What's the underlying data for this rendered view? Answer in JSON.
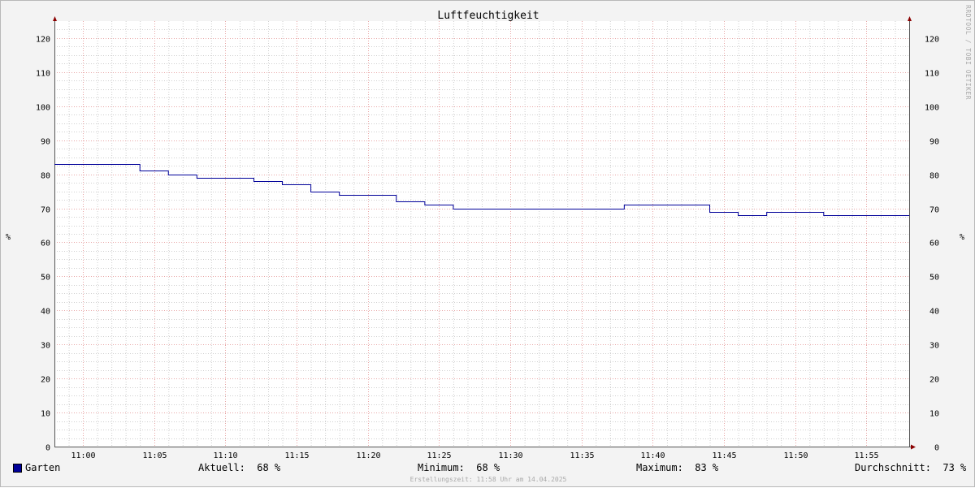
{
  "chart_data": {
    "type": "line",
    "title": "Luftfeuchtigkeit",
    "ylabel": "%",
    "ylim": [
      0,
      125
    ],
    "y_ticks": [
      0,
      10,
      20,
      30,
      40,
      50,
      60,
      70,
      80,
      90,
      100,
      110,
      120
    ],
    "x_range": [
      "10:58",
      "11:58"
    ],
    "x_ticks": [
      "11:00",
      "11:05",
      "11:10",
      "11:15",
      "11:20",
      "11:25",
      "11:30",
      "11:35",
      "11:40",
      "11:45",
      "11:50",
      "11:55"
    ],
    "grid": true,
    "legend": "bottom-left",
    "series": [
      {
        "name": "Garten",
        "color": "#000099",
        "step": true,
        "points": [
          [
            "10:58",
            83
          ],
          [
            "11:04",
            81
          ],
          [
            "11:06",
            80
          ],
          [
            "11:08",
            79
          ],
          [
            "11:12",
            78
          ],
          [
            "11:14",
            77
          ],
          [
            "11:16",
            75
          ],
          [
            "11:18",
            74
          ],
          [
            "11:22",
            72
          ],
          [
            "11:24",
            71
          ],
          [
            "11:26",
            70
          ],
          [
            "11:38",
            71
          ],
          [
            "11:44",
            69
          ],
          [
            "11:46",
            68
          ],
          [
            "11:48",
            69
          ],
          [
            "11:52",
            68
          ],
          [
            "11:58",
            68
          ]
        ]
      }
    ]
  },
  "legend": {
    "swatch_color": "#000099",
    "series_name": "Garten",
    "current": "Aktuell:  68 %",
    "minimum": "Minimum:  68 %",
    "maximum": "Maximum:  83 %",
    "average": "Durchschnitt:  73 %"
  },
  "watermark": "RRDTOOL / TOBI OETIKER",
  "footer": "Erstellungszeit: 11:58 Uhr am 14.04.2025",
  "colors": {
    "background": "#f3f3f3",
    "plot_background": "#ffffff",
    "major_grid": "#e8a6a6",
    "minor_grid": "#cfcfcf",
    "axis": "#555555",
    "arrow": "#8b0000"
  }
}
